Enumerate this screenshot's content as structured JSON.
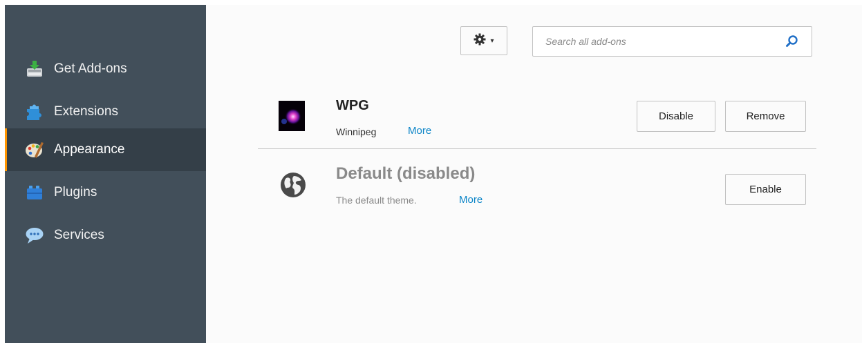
{
  "sidebar": {
    "items": [
      {
        "label": "Get Add-ons",
        "icon": "get-addons-icon",
        "selected": false
      },
      {
        "label": "Extensions",
        "icon": "puzzle-piece-icon",
        "selected": false
      },
      {
        "label": "Appearance",
        "icon": "palette-icon",
        "selected": true
      },
      {
        "label": "Plugins",
        "icon": "plugin-brick-icon",
        "selected": false
      },
      {
        "label": "Services",
        "icon": "speech-bubble-icon",
        "selected": false
      }
    ],
    "accent_color": "#ff9500"
  },
  "toolbar": {
    "tools_menu_icon": "gear-icon",
    "search_placeholder": "Search all add-ons",
    "search_value": "",
    "search_icon": "magnifier-icon"
  },
  "addons": [
    {
      "name": "WPG",
      "description": "Winnipeg",
      "more": "More",
      "buttons": [
        "Disable",
        "Remove"
      ],
      "disabled": false
    },
    {
      "name": "Default  (disabled)",
      "description": "The default theme.",
      "more": "More",
      "buttons": [
        "Enable"
      ],
      "disabled": true
    }
  ],
  "colors": {
    "sidebar_bg": "#424f5a",
    "sidebar_selected_bg": "#343f48",
    "link": "#0a84c7",
    "disabled_text": "#8a8a8a"
  }
}
